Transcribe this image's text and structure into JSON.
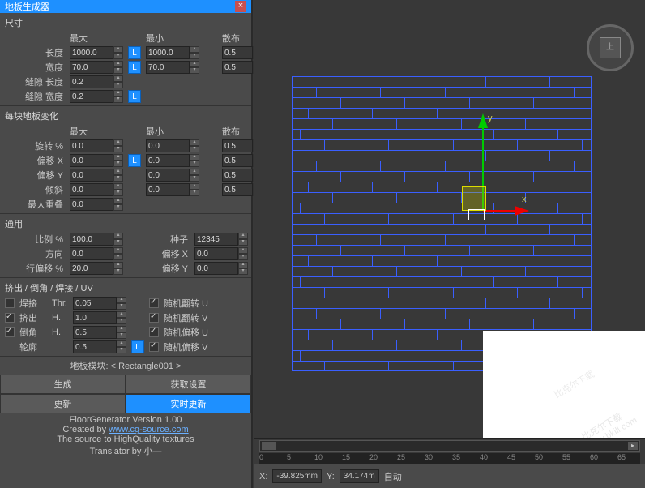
{
  "window": {
    "title": "地板生成器",
    "close": "×"
  },
  "sections": {
    "size": {
      "title": "尺寸",
      "cols": {
        "max": "最大",
        "min": "最小",
        "spread": "散布"
      },
      "length": {
        "lbl": "长度",
        "max": "1000.0",
        "min": "1000.0",
        "spread": "0.5"
      },
      "width": {
        "lbl": "宽度",
        "max": "70.0",
        "min": "70.0",
        "spread": "0.5"
      },
      "gap_len": {
        "lbl": "缝隙 长度",
        "val": "0.2"
      },
      "gap_wid": {
        "lbl": "缝隙 宽度",
        "val": "0.2"
      }
    },
    "var": {
      "title": "每块地板变化",
      "cols": {
        "max": "最大",
        "min": "最小",
        "spread": "散布"
      },
      "rot": {
        "lbl": "旋转 %",
        "max": "0.0",
        "min": "0.0",
        "spread": "0.5"
      },
      "offx": {
        "lbl": "偏移 X",
        "max": "0.0",
        "min": "0.0",
        "spread": "0.5"
      },
      "offy": {
        "lbl": "偏移 Y",
        "max": "0.0",
        "min": "0.0",
        "spread": "0.5"
      },
      "tilt": {
        "lbl": "倾斜",
        "max": "0.0",
        "min": "0.0",
        "spread": "0.5"
      },
      "overlap": {
        "lbl": "最大重叠",
        "val": "0.0"
      }
    },
    "gen": {
      "title": "通用",
      "scale": {
        "lbl": "比例 %",
        "val": "100.0"
      },
      "seed": {
        "lbl": "种子",
        "val": "12345"
      },
      "dir": {
        "lbl": "方向",
        "val": "0.0"
      },
      "ofx": {
        "lbl": "偏移 X",
        "val": "0.0"
      },
      "rowoff": {
        "lbl": "行偏移 %",
        "val": "20.0"
      },
      "ofy": {
        "lbl": "偏移 Y",
        "val": "0.0"
      }
    },
    "ext": {
      "title": "挤出 / 倒角 / 焊接 / UV",
      "weld": {
        "lbl": "焊接",
        "p": "Thr.",
        "val": "0.05"
      },
      "extrude": {
        "lbl": "挤出",
        "p": "H.",
        "val": "1.0"
      },
      "bevel": {
        "lbl": "倒角",
        "p": "H.",
        "val": "0.5"
      },
      "outline": {
        "lbl": "轮廓",
        "val": "0.5"
      },
      "flipU": "随机翻转 U",
      "flipV": "随机翻转 V",
      "offU": "随机偏移 U",
      "offV": "随机偏移 V"
    },
    "module": {
      "lbl": "地板模块: ",
      "val": "< Rectangle001 >"
    },
    "buttons": {
      "gen": "生成",
      "get": "获取设置",
      "upd": "更新",
      "live": "实时更新"
    },
    "credits": {
      "l1": "FloorGenerator Version 1.00",
      "l2a": "Created by ",
      "l2b": "www.cg-source.com",
      "l3": "The source to HighQuality textures",
      "l4": "Translator by 小—"
    }
  },
  "lock": "L",
  "viewport": {
    "cube": "上",
    "axis_x": "x",
    "axis_y": "y"
  },
  "timeline": {
    "ticks": [
      "0",
      "5",
      "10",
      "15",
      "20",
      "25",
      "30",
      "35",
      "40",
      "45",
      "50",
      "55",
      "60",
      "65"
    ]
  },
  "status": {
    "x_lbl": "X:",
    "x": "-39.825mm",
    "y_lbl": "Y:",
    "y": "34.174m",
    "auto": "自动"
  },
  "watermark": {
    "a": "比克尔下载",
    "b": "www.bkill.com"
  }
}
